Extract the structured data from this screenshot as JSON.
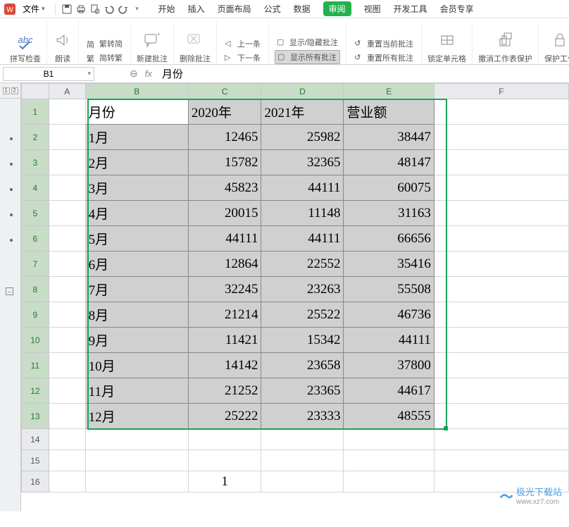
{
  "menu": {
    "file": "文件",
    "tabs": [
      "开始",
      "插入",
      "页面布局",
      "公式",
      "数据",
      "审阅",
      "视图",
      "开发工具",
      "会员专享"
    ],
    "active_tab": "审阅"
  },
  "ribbon": {
    "spellcheck": "拼写检查",
    "read_aloud": "朗读",
    "simp_trad": {
      "to_simp": "繁转简",
      "to_trad": "简转繁"
    },
    "new_comment": "新建批注",
    "del_comment": "删除批注",
    "prev": "上一条",
    "next": "下一条",
    "show_hide": "显示/隐藏批注",
    "show_all": "显示所有批注",
    "reset_current": "重置当前批注",
    "reset_all": "重置所有批注",
    "lock_cell": "锁定单元格",
    "unprotect_sheet": "撤消工作表保护",
    "protect_wb": "保护工作"
  },
  "namebox": "B1",
  "formula_value": "月份",
  "columns": [
    "A",
    "B",
    "C",
    "D",
    "E",
    "F"
  ],
  "headers": {
    "b": "月份",
    "c": "2020年",
    "d": "2021年",
    "e": "营业额"
  },
  "rows": [
    {
      "b": "1月",
      "c": 12465,
      "d": 25982,
      "e": 38447
    },
    {
      "b": "2月",
      "c": 15782,
      "d": 32365,
      "e": 48147
    },
    {
      "b": "3月",
      "c": 45823,
      "d": 44111,
      "e": 60075
    },
    {
      "b": "4月",
      "c": 20015,
      "d": 11148,
      "e": 31163
    },
    {
      "b": "5月",
      "c": 44111,
      "d": 44111,
      "e": 66656
    },
    {
      "b": "6月",
      "c": 12864,
      "d": 22552,
      "e": 35416
    },
    {
      "b": "7月",
      "c": 32245,
      "d": 23263,
      "e": 55508
    },
    {
      "b": "8月",
      "c": 21214,
      "d": 25522,
      "e": 46736
    },
    {
      "b": "9月",
      "c": 11421,
      "d": 15342,
      "e": 44111
    },
    {
      "b": "10月",
      "c": 14142,
      "d": 23658,
      "e": 37800
    },
    {
      "b": "11月",
      "c": 21252,
      "d": 23365,
      "e": 44617
    },
    {
      "b": "12月",
      "c": 25222,
      "d": 23333,
      "e": 48555
    }
  ],
  "empty_row16_c": "1",
  "watermark": {
    "name": "极光下载站",
    "url": "www.xz7.com"
  }
}
